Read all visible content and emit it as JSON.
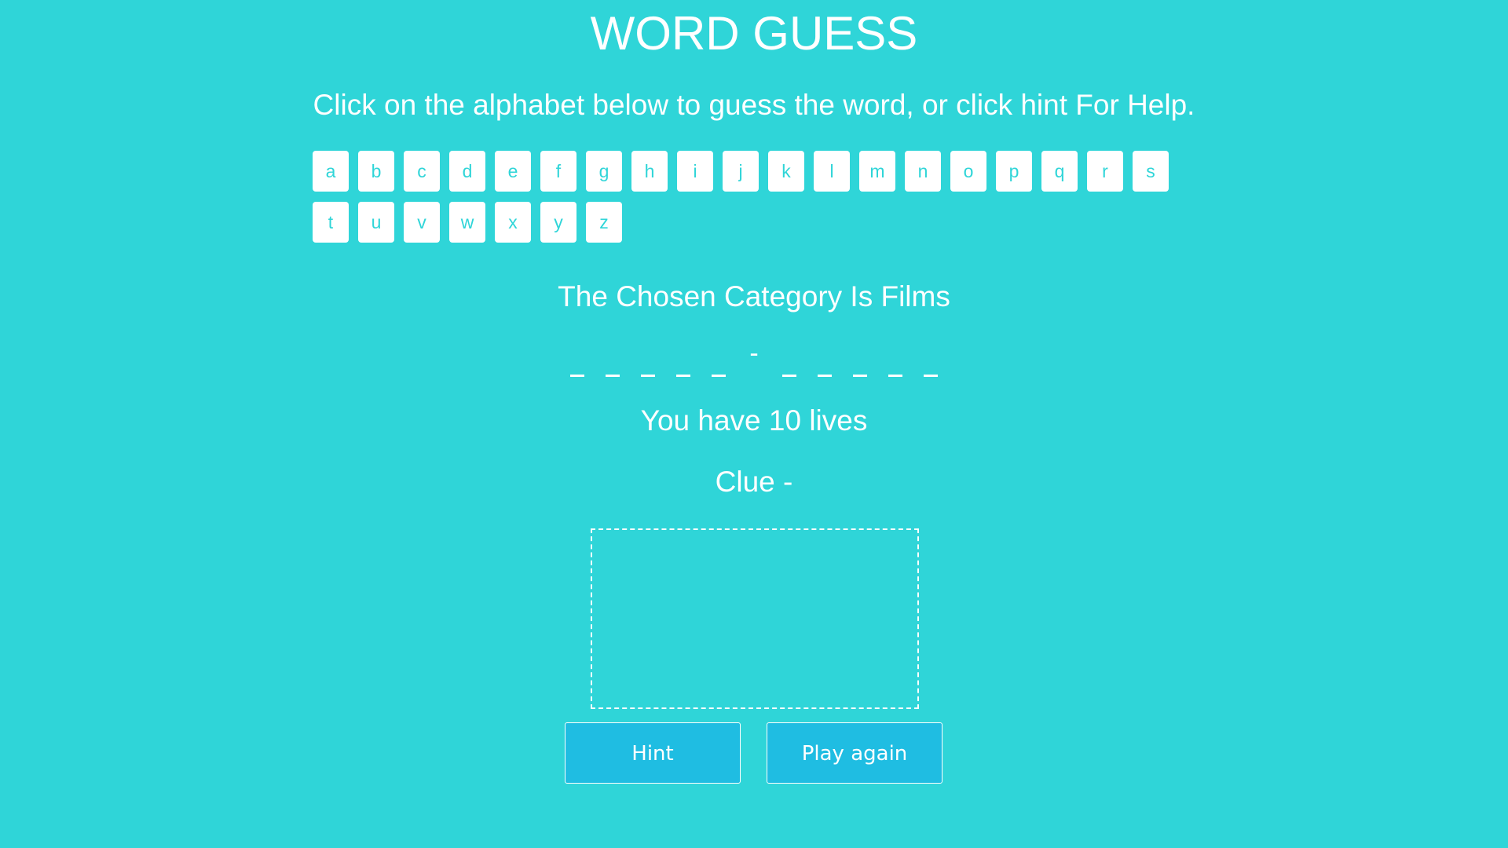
{
  "header": {
    "title": "WORD GUESS",
    "instructions": "Click on the alphabet below to guess the word, or click hint For Help."
  },
  "keyboard": {
    "letters": [
      "a",
      "b",
      "c",
      "d",
      "e",
      "f",
      "g",
      "h",
      "i",
      "j",
      "k",
      "l",
      "m",
      "n",
      "o",
      "p",
      "q",
      "r",
      "s",
      "t",
      "u",
      "v",
      "w",
      "x",
      "y",
      "z"
    ]
  },
  "game": {
    "category": "The Chosen Category Is Films",
    "word_slots": [
      "_",
      "_",
      "_",
      "_",
      "_",
      "-",
      "_",
      "_",
      "_",
      "_",
      "_"
    ],
    "lives": "You have 10 lives",
    "clue": "Clue -"
  },
  "buttons": {
    "hint": "Hint",
    "play_again": "Play again"
  },
  "colors": {
    "background": "#2fd5d8",
    "button_fill": "#1fbde2",
    "text": "#ffffff"
  }
}
